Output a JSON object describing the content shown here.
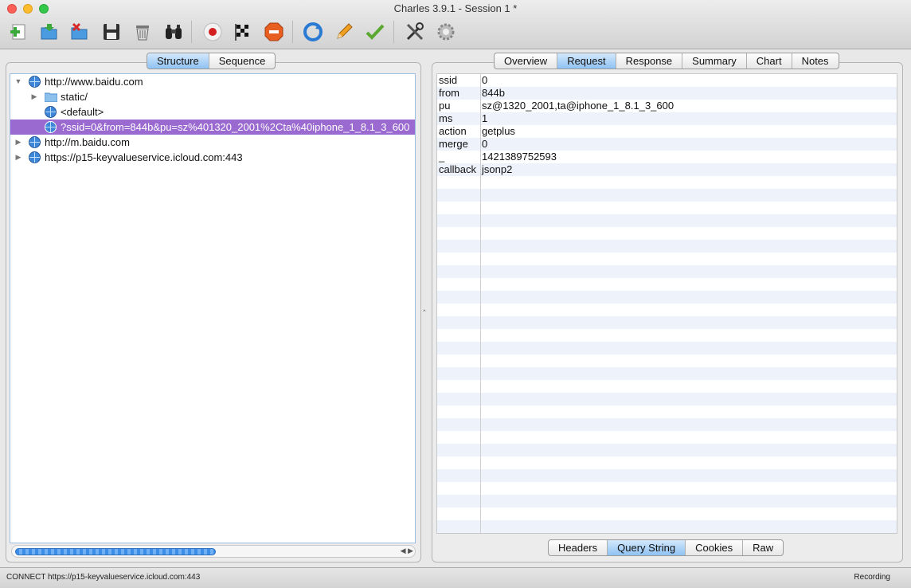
{
  "window": {
    "title": "Charles 3.9.1 - Session 1 *"
  },
  "toolbar": {
    "icons": [
      "new-session-icon",
      "open-icon",
      "close-session-icon",
      "save-icon",
      "clear-icon",
      "find-icon",
      "record-icon",
      "throttle-icon",
      "breakpoints-icon",
      "repeat-icon",
      "edit-icon",
      "validate-icon",
      "tools-icon",
      "settings-icon"
    ]
  },
  "left_tabs": [
    "Structure",
    "Sequence"
  ],
  "left_active_tab": "Structure",
  "tree": [
    {
      "label": "http://www.baidu.com",
      "expanded": true
    },
    {
      "label": "static/",
      "type": "folder"
    },
    {
      "label": "<default>"
    },
    {
      "label": "?ssid=0&from=844b&pu=sz%401320_2001%2Cta%40iphone_1_8.1_3_600",
      "selected": true
    },
    {
      "label": "http://m.baidu.com",
      "expanded": false
    },
    {
      "label": "https://p15-keyvalueservice.icloud.com:443",
      "expanded": false
    }
  ],
  "right_tabs": [
    "Overview",
    "Request",
    "Response",
    "Summary",
    "Chart",
    "Notes"
  ],
  "right_active_tab": "Request",
  "query_string": [
    {
      "key": "ssid",
      "value": "0"
    },
    {
      "key": "from",
      "value": "844b"
    },
    {
      "key": "pu",
      "value": "sz@1320_2001,ta@iphone_1_8.1_3_600"
    },
    {
      "key": "ms",
      "value": "1"
    },
    {
      "key": "action",
      "value": "getplus"
    },
    {
      "key": "merge",
      "value": "0"
    },
    {
      "key": "_",
      "value": "1421389752593"
    },
    {
      "key": "callback",
      "value": "jsonp2"
    }
  ],
  "bottom_tabs": [
    "Headers",
    "Query String",
    "Cookies",
    "Raw"
  ],
  "bottom_active_tab": "Query String",
  "status": {
    "text": "CONNECT https://p15-keyvalueservice.icloud.com:443",
    "recording": "Recording"
  },
  "colors": {
    "selection": "#9b6ad0",
    "active_tab": "#8fc2f3"
  }
}
